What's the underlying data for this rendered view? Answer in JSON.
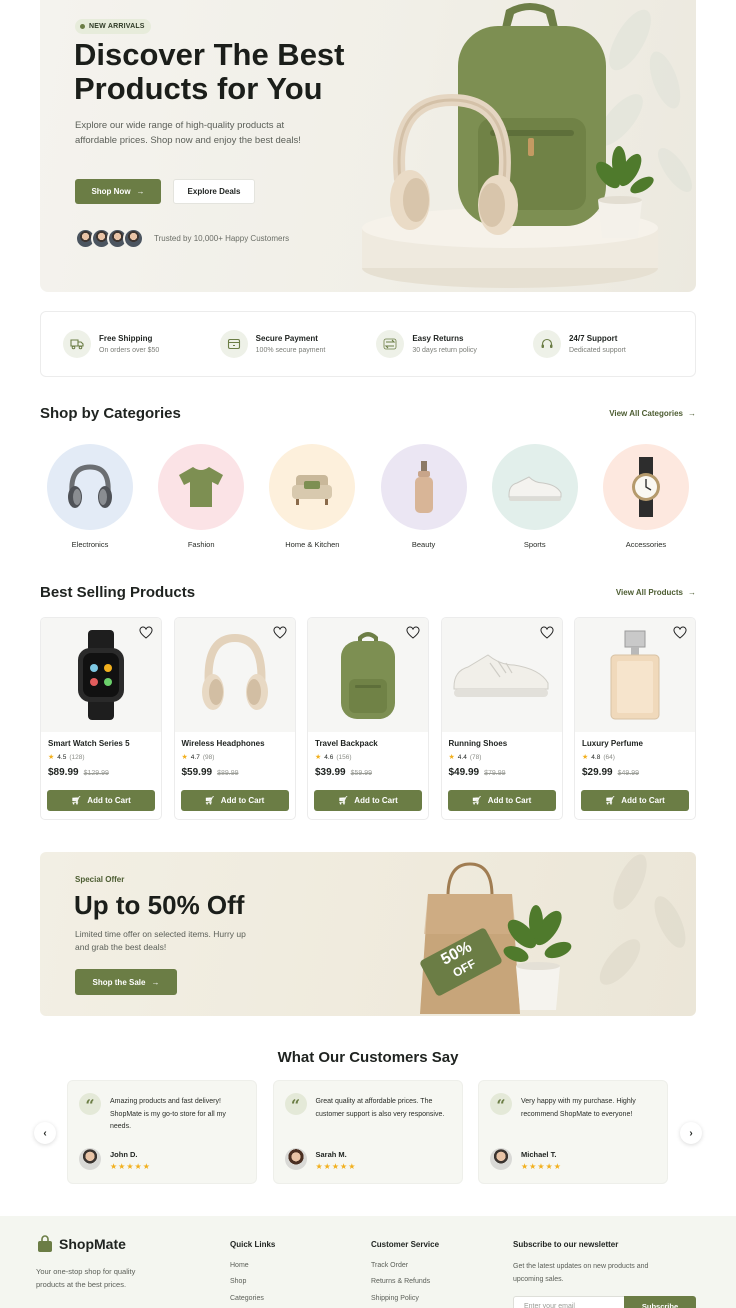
{
  "hero": {
    "badge": "NEW ARRIVALS",
    "title_line1": "Discover The Best",
    "title_line2": "Products for You",
    "subtitle": "Explore our wide range of high-quality products at affordable prices. Shop now and enjoy the best deals!",
    "shop_now": "Shop Now",
    "explore_deals": "Explore Deals",
    "trusted": "Trusted by 10,000+ Happy Customers"
  },
  "features": [
    {
      "title": "Free Shipping",
      "subtitle": "On orders over $50",
      "icon": "truck-icon"
    },
    {
      "title": "Secure Payment",
      "subtitle": "100% secure payment",
      "icon": "wallet-icon"
    },
    {
      "title": "Easy Returns",
      "subtitle": "30 days return policy",
      "icon": "return-icon"
    },
    {
      "title": "24/7 Support",
      "subtitle": "Dedicated support",
      "icon": "headset-icon"
    }
  ],
  "categories": {
    "title": "Shop by Categories",
    "view_all": "View All Categories",
    "items": [
      {
        "label": "Electronics",
        "bg": "#e3ebf6"
      },
      {
        "label": "Fashion",
        "bg": "#fbe3e6"
      },
      {
        "label": "Home & Kitchen",
        "bg": "#fdf0dc"
      },
      {
        "label": "Beauty",
        "bg": "#ebe6f3"
      },
      {
        "label": "Sports",
        "bg": "#e2efeb"
      },
      {
        "label": "Accessories",
        "bg": "#fde8df"
      }
    ]
  },
  "best_selling": {
    "title": "Best Selling Products",
    "view_all": "View All Products",
    "add_to_cart": "Add to Cart",
    "products": [
      {
        "name": "Smart Watch Series 5",
        "rating": "4.5",
        "count": "(128)",
        "price": "$89.99",
        "old_price": "$129.99"
      },
      {
        "name": "Wireless Headphones",
        "rating": "4.7",
        "count": "(98)",
        "price": "$59.99",
        "old_price": "$89.99"
      },
      {
        "name": "Travel Backpack",
        "rating": "4.6",
        "count": "(156)",
        "price": "$39.99",
        "old_price": "$59.99"
      },
      {
        "name": "Running Shoes",
        "rating": "4.4",
        "count": "(78)",
        "price": "$49.99",
        "old_price": "$79.99"
      },
      {
        "name": "Luxury Perfume",
        "rating": "4.8",
        "count": "(64)",
        "price": "$29.99",
        "old_price": "$49.99"
      }
    ]
  },
  "promo": {
    "kicker": "Special Offer",
    "title": "Up to 50% Off",
    "subtitle": "Limited time offer on selected items. Hurry up and grab the best deals!",
    "button": "Shop the Sale",
    "tag_line1": "50%",
    "tag_line2": "OFF"
  },
  "testimonials": {
    "title": "What Our Customers Say",
    "items": [
      {
        "text": "Amazing products and fast delivery! ShopMate is my go-to store for all my needs.",
        "name": "John D.",
        "stars": "★★★★★"
      },
      {
        "text": "Great quality at affordable prices. The customer support is also very responsive.",
        "name": "Sarah M.",
        "stars": "★★★★★"
      },
      {
        "text": "Very happy with my purchase. Highly recommend ShopMate to everyone!",
        "name": "Michael T.",
        "stars": "★★★★★"
      }
    ]
  },
  "footer": {
    "brand": "ShopMate",
    "description": "Your one-stop shop for quality products at the best prices.",
    "quick_links_title": "Quick Links",
    "quick_links": [
      "Home",
      "Shop",
      "Categories"
    ],
    "service_title": "Customer Service",
    "service_links": [
      "Track Order",
      "Returns & Refunds",
      "Shipping Policy"
    ],
    "newsletter_title": "Subscribe to our newsletter",
    "newsletter_text": "Get the latest updates on new products and upcoming sales.",
    "email_placeholder": "Enter your email",
    "subscribe": "Subscribe"
  },
  "colors": {
    "accent": "#6b7d45",
    "star": "#f2b01e"
  }
}
